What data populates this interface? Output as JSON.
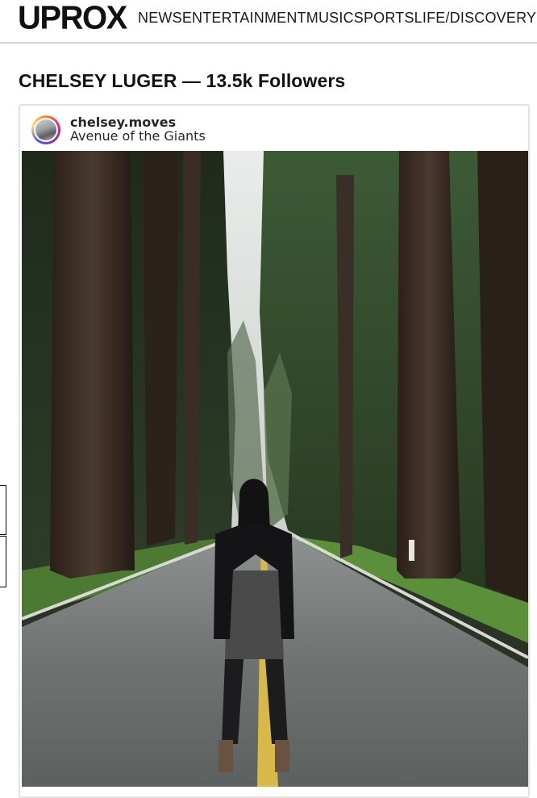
{
  "site": {
    "logo": "UPROX",
    "nav": [
      "NEWS",
      "ENTERTAINMENT",
      "MUSIC",
      "SPORTS",
      "LIFE/",
      "DISCOVERY"
    ]
  },
  "profile": {
    "heading": "CHELSEY LUGER — 13.5k Followers"
  },
  "post": {
    "username": "chelsey.moves",
    "location": "Avenue of the Giants",
    "photo_icon": "forest-road-photo",
    "avatar_icon": "profile-avatar"
  },
  "colors": {
    "accent_ring": "#dd2a7b",
    "text": "#262626",
    "divider": "#d4d4d4"
  }
}
